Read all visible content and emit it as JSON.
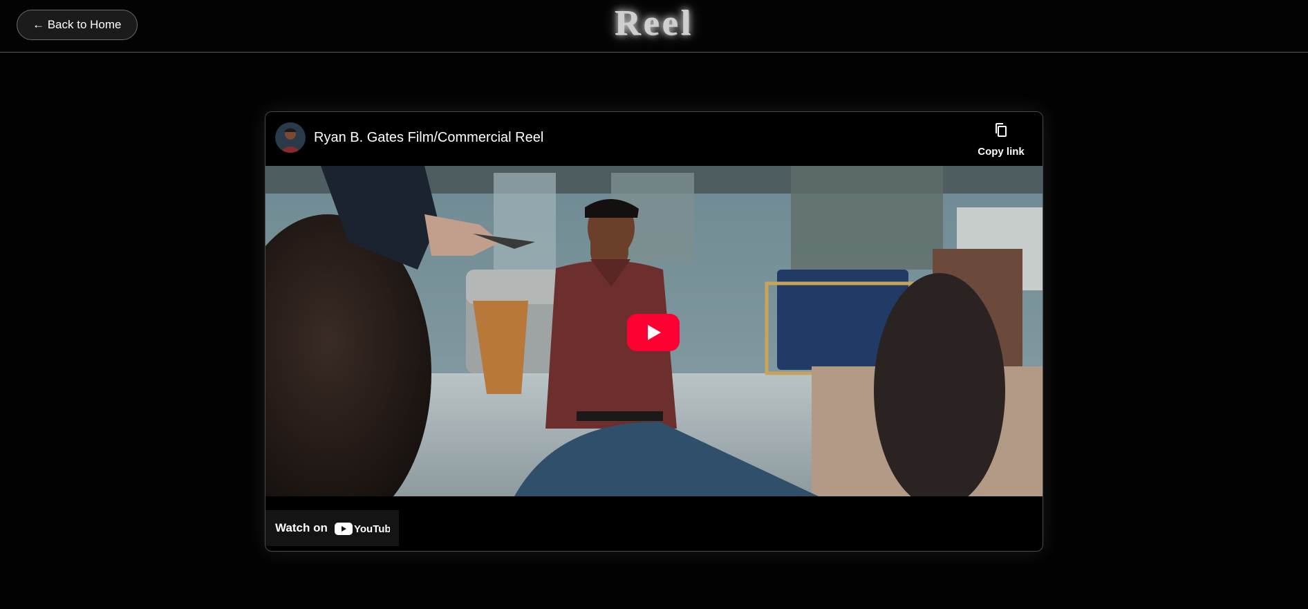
{
  "header": {
    "back_label": "← Back to Home",
    "logo_text": "Reel"
  },
  "video": {
    "title": "Ryan B. Gates Film/Commercial Reel",
    "copy_link_label": "Copy link",
    "watch_on_label": "Watch on",
    "platform_name": "YouTube"
  },
  "colors": {
    "background": "#020202",
    "youtube_red": "#ff0033",
    "text": "#ffffff"
  },
  "icons": [
    "avatar",
    "copy-icon",
    "play-icon",
    "youtube-logo-icon"
  ]
}
